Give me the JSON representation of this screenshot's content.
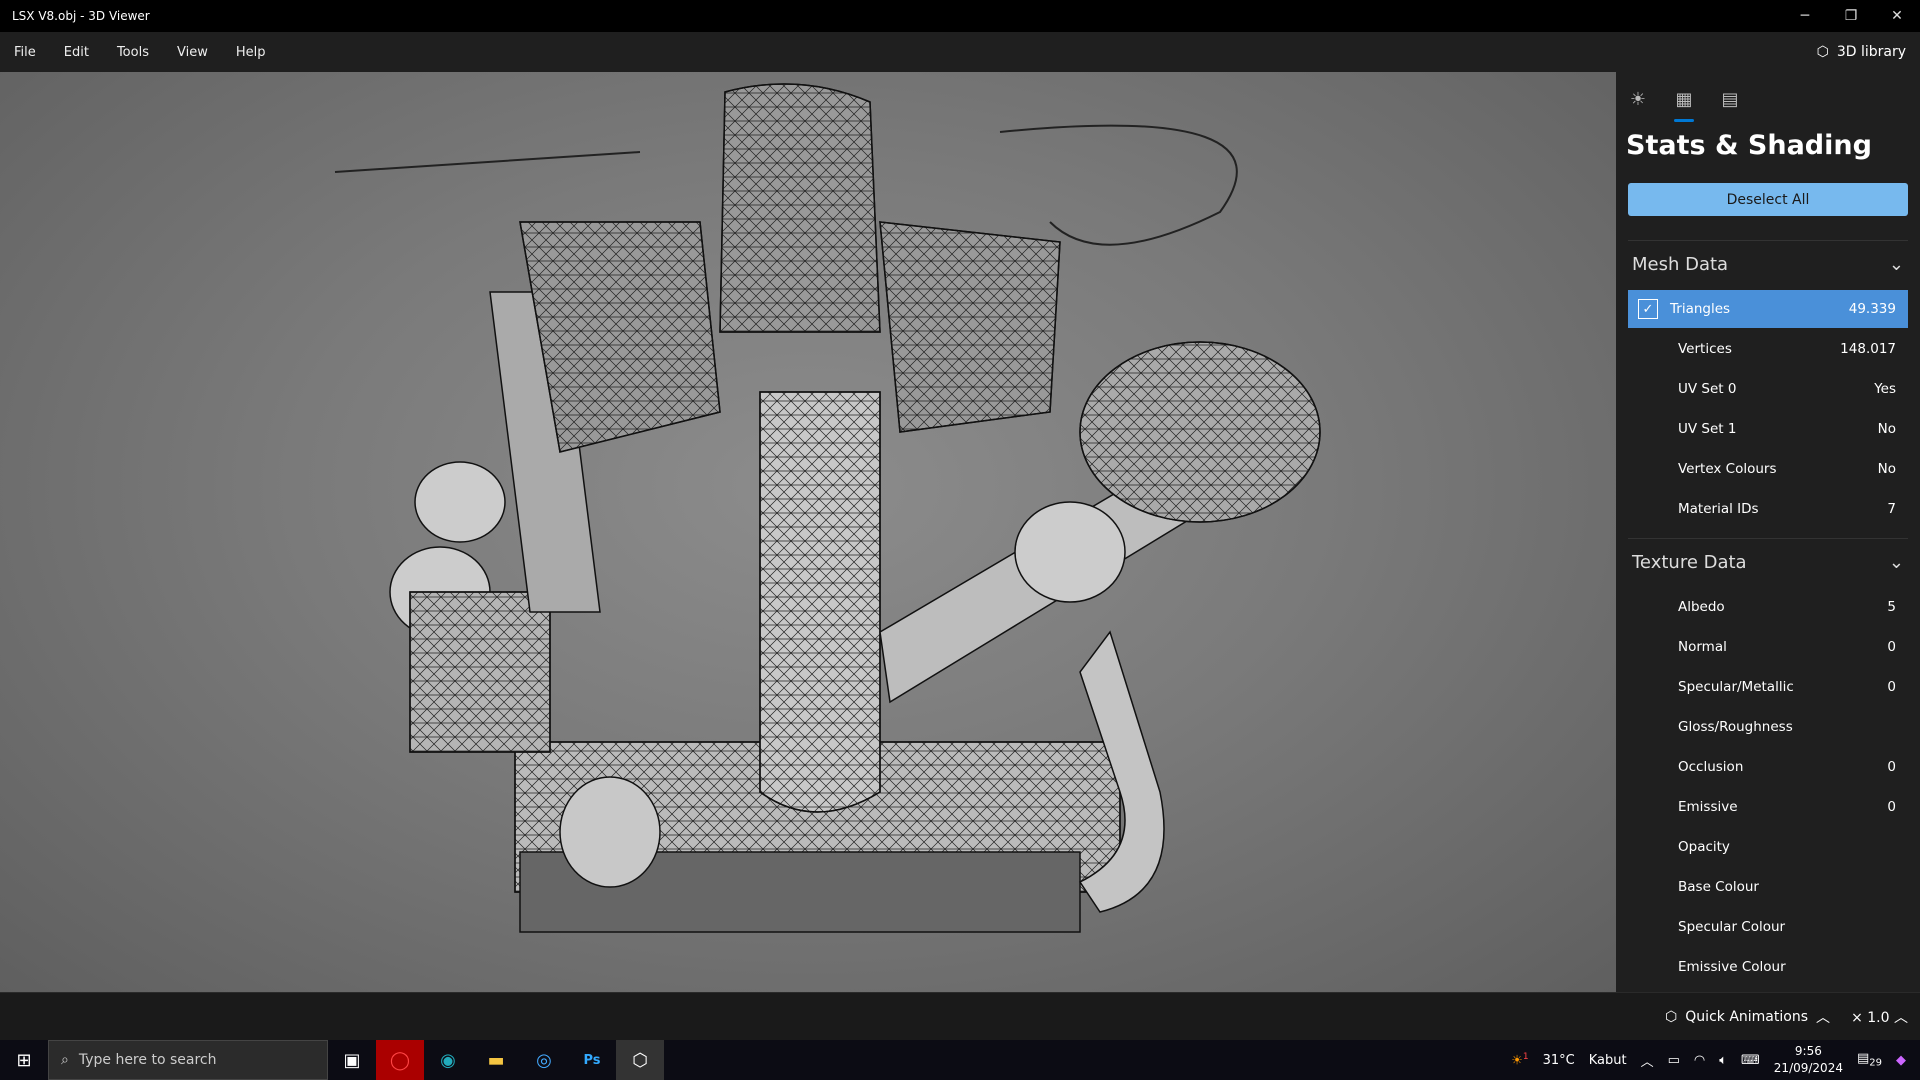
{
  "window": {
    "title": "LSX V8.obj - 3D Viewer",
    "minimize": "─",
    "restore": "❐",
    "close": "✕"
  },
  "menu": [
    "File",
    "Edit",
    "Tools",
    "View",
    "Help"
  ],
  "library_label": "3D library",
  "panel": {
    "title": "Stats & Shading",
    "deselect_label": "Deselect All",
    "mesh_header": "Mesh Data",
    "mesh_rows": [
      {
        "label": "Triangles",
        "value": "49.339",
        "selected": true
      },
      {
        "label": "Vertices",
        "value": "148.017"
      },
      {
        "label": "UV Set 0",
        "value": "Yes"
      },
      {
        "label": "UV Set 1",
        "value": "No"
      },
      {
        "label": "Vertex Colours",
        "value": "No"
      },
      {
        "label": "Material IDs",
        "value": "7"
      }
    ],
    "texture_header": "Texture Data",
    "texture_rows": [
      {
        "label": "Albedo",
        "value": "5"
      },
      {
        "label": "Normal",
        "value": "0"
      },
      {
        "label": "Specular/Metallic",
        "value": "0"
      },
      {
        "label": "Gloss/Roughness",
        "value": ""
      },
      {
        "label": "Occlusion",
        "value": "0"
      },
      {
        "label": "Emissive",
        "value": "0"
      },
      {
        "label": "Opacity",
        "value": ""
      },
      {
        "label": "Base Colour",
        "value": ""
      },
      {
        "label": "Specular Colour",
        "value": ""
      },
      {
        "label": "Emissive Colour",
        "value": ""
      }
    ]
  },
  "bottom": {
    "quick_animations": "Quick Animations",
    "speed": "× 1.0"
  },
  "taskbar": {
    "search_placeholder": "Type here to search",
    "weather_temp": "31°C",
    "weather_text": "Kabut",
    "weather_badge": "1",
    "time": "9:56",
    "date": "21/09/2024",
    "notifications": "29"
  },
  "colors": {
    "accent": "#77b9ee",
    "selected_row": "#4a90d9"
  }
}
